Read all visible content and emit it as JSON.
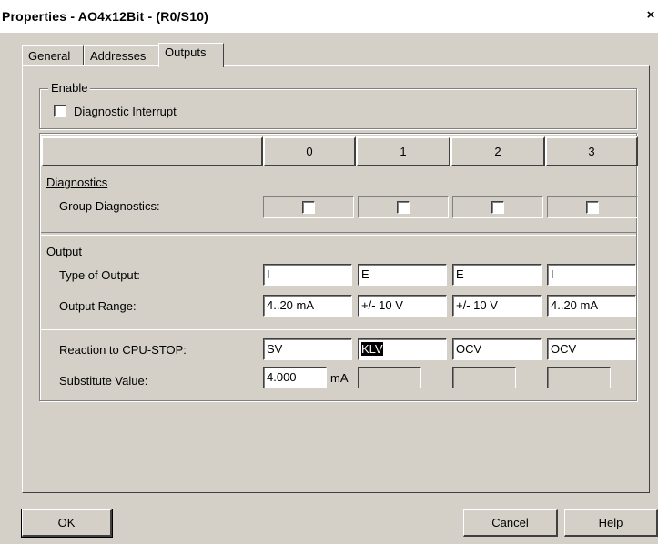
{
  "window": {
    "title": "Properties - AO4x12Bit - (R0/S10)",
    "close_glyph": "×"
  },
  "tabs": [
    {
      "label": "General"
    },
    {
      "label": "Addresses"
    },
    {
      "label": "Outputs",
      "active": true
    }
  ],
  "enable": {
    "legend": "Enable",
    "diagnostic_interrupt": {
      "label": "Diagnostic Interrupt",
      "checked": false
    }
  },
  "table": {
    "channels": [
      "0",
      "1",
      "2",
      "3"
    ],
    "diagnostics": {
      "section": "Diagnostics",
      "group_label": "Group Diagnostics:",
      "checked": [
        false,
        false,
        false,
        false
      ]
    },
    "output": {
      "section": "Output",
      "type_label": "Type of Output:",
      "types": [
        "I",
        "E",
        "E",
        "I"
      ],
      "range_label": "Output Range:",
      "ranges": [
        "4..20 mA",
        "+/- 10 V",
        "+/- 10 V",
        "4..20 mA"
      ]
    },
    "cpu_stop": {
      "reaction_label": "Reaction to CPU-STOP:",
      "reactions": [
        "SV",
        "KLV",
        "OCV",
        "OCV"
      ],
      "substitute_label": "Substitute Value:",
      "substitute_value": "4.000",
      "unit": "mA"
    }
  },
  "buttons": {
    "ok": "OK",
    "cancel": "Cancel",
    "help": "Help"
  }
}
